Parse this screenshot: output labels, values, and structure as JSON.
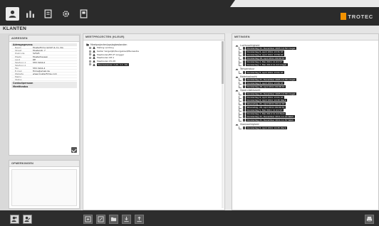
{
  "brand": {
    "name": "TROTEC"
  },
  "titlebar": {
    "title": "KLANTEN"
  },
  "nav": {
    "items": [
      {
        "icon": "customers-icon",
        "active": true
      },
      {
        "icon": "chart-icon",
        "active": false
      },
      {
        "icon": "document-icon",
        "active": false
      },
      {
        "icon": "gear-icon",
        "active": false
      },
      {
        "icon": "report-icon",
        "active": false
      }
    ]
  },
  "address": {
    "header": "ADRESSEN",
    "section1": "Adresgegevens",
    "rows": [
      {
        "k": "Naam",
        "v": "Musterfirma GmbH & Co. KG"
      },
      {
        "k": "Straat",
        "v": "Musterstr. 7"
      },
      {
        "k": "Postcode",
        "v": "52525"
      },
      {
        "k": "Plaats",
        "v": "Musterhausen"
      },
      {
        "k": "Land",
        "v": "DE"
      },
      {
        "k": "Telefoon 1",
        "v": "555 3224-0"
      },
      {
        "k": "Telefoon 2",
        "v": ""
      },
      {
        "k": "Fax",
        "v": "555 3224-4"
      },
      {
        "k": "E-mail",
        "v": "firma@email.de"
      },
      {
        "k": "Website",
        "v": "www.musterfirma.com"
      },
      {
        "k": "Memo",
        "v": ""
      },
      {
        "k": "Status",
        "v": ""
      }
    ],
    "section2": "Contactpersoon",
    "section3": "Meetfondus"
  },
  "notes": {
    "header": "OPMERKINGEN"
  },
  "projects": {
    "header": "MEETPROJECTEN (KLEUR)",
    "root": "Meetprojecten/opslagbestanden",
    "items": [
      {
        "label": "Meting Lentiorg",
        "selected": false
      },
      {
        "label": "Kelder Vergelijkt/Kuurgebied/Mecaastre",
        "selected": false
      },
      {
        "label": "Meetzuilen/Elf (Fl Lingger",
        "selected": false
      },
      {
        "label": "Meetzuilen 08 A",
        "selected": false
      },
      {
        "label": "Meetzuilen 05-08",
        "selected": false
      },
      {
        "label": "Muursensoren 2 (Kl. 1.1, 02)",
        "selected": true
      }
    ]
  },
  "visits": {
    "header": "METINGEN",
    "groups": [
      {
        "label": "Luchtvochtigheid",
        "entries": [
          "Donderdag 21, December 2005 10:59 Uregel",
          "Donderdag 8, April 2011 13:31 ST",
          "Donderdag 8, April 2011 13:56 ST",
          "Donderdag 28, April 2011 09:09 ST",
          "Donderdag 2, Mei 2011 11:21 ST",
          "Donderdag 7, Mei 2014 11:14 Uregel"
        ]
      },
      {
        "label": "Temperatuur",
        "entries": [
          "Donderdag 8, April 2011 13:01 ST"
        ]
      },
      {
        "label": "Materiaalvocht",
        "entries": [
          "Donderdag 21, December 2005 10:58 Uregel",
          "Donderdag 8, April 2011 13:06 ST",
          "Donderdag 28, April 2011 09:08 ST"
        ]
      },
      {
        "label": "Oppervlaktevocht",
        "entries": [
          "Donderdag 21, December 2005 10:58 Uregel",
          "Donderdag 8, April 2011 13:01 ST",
          "Donderdag 8, April 2011 14:45 Werk",
          "Woensdag, 21, April 2011 09:12 ST",
          "Woensdag, 28, April 2011 09:09 ST",
          "Donderdag 5, Mei 2011 11:21 ST",
          "Donderdag 7, Mei 2014 11:14 Werk",
          "Donderdag 21, December 2011 11:14 Werk",
          "Donderdag 21, December 2011 11:57 Werk"
        ]
      },
      {
        "label": "Vloeivochtigheid",
        "entries": [
          "Donderdag 8, April 2011 14:45 Werk"
        ]
      }
    ]
  },
  "bottom": {
    "left": [
      "add-customer-icon",
      "edit-customer-icon"
    ],
    "middle": [
      "add-project-icon",
      "edit-project-icon",
      "folder-icon",
      "download-icon",
      "upload-icon"
    ],
    "right": [
      "print-icon"
    ]
  }
}
